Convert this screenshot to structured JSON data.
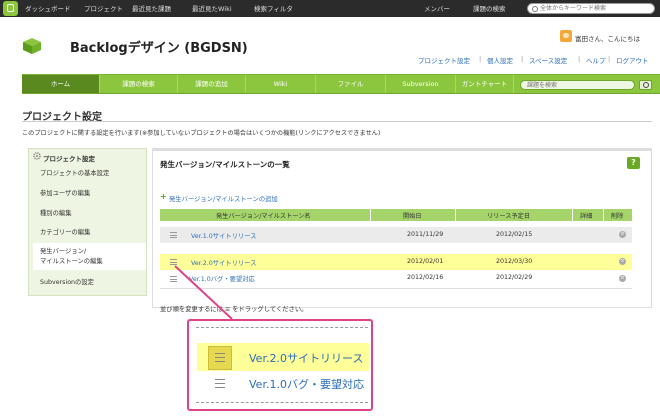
{
  "topbar": {
    "links": [
      "ダッシュボード",
      "プロジェクト",
      "最近見た課題",
      "最近見たWiki",
      "検索フィルタ"
    ],
    "right_links": [
      "メンバー",
      "課題の検索"
    ],
    "search_placeholder": "全体からキーワード検索"
  },
  "header": {
    "project_title": "Backlogデザイン (BGDSN)",
    "user_greeting": "富田さん、こんにちは",
    "links": [
      "プロジェクト設定",
      "個人設定",
      "スペース設定",
      "ヘルプ",
      "ログアウト"
    ]
  },
  "nav": {
    "tabs": [
      "ホーム",
      "課題の検索",
      "課題の追加",
      "Wiki",
      "ファイル",
      "Subversion",
      "ガントチャート"
    ],
    "search_placeholder": "課題を検索"
  },
  "page": {
    "title": "プロジェクト設定",
    "description": "このプロジェクトに関する設定を行います(※参加していないプロジェクトの場合はいくつかの機能(リンクにアクセスできません)"
  },
  "sidebar": {
    "heading": "プロジェクト設定",
    "items": [
      "プロジェクトの基本設定",
      "参加ユーザの編集",
      "種別の編集",
      "カテゴリーの編集",
      "発生バージョン/",
      "マイルストーンの編集",
      "Subversionの設定"
    ]
  },
  "main": {
    "title": "発生バージョン/マイルストーンの一覧",
    "help_label": "?",
    "add_link": "発生バージョン/マイルストーンの追加",
    "columns": [
      "発生バージョン/マイルストーン名",
      "開始日",
      "リリース予定日",
      "詳細",
      "削除"
    ],
    "rows": [
      {
        "name": "Ver.1.0サイトリリース",
        "start": "2011/11/29",
        "release": "2012/02/15"
      },
      {
        "name": "Ver.2.0サイトリリース",
        "start": "2012/02/01",
        "release": "2012/03/30"
      },
      {
        "name": "Ver.1.0バグ・要望対応",
        "start": "2012/02/16",
        "release": "2012/02/29"
      }
    ],
    "reorder_note": "並び順を変更するには ≡ をドラッグしてください。"
  },
  "callout": {
    "rows": [
      "Ver.2.0サイトリリース",
      "Ver.1.0バグ・要望対応"
    ]
  },
  "colors": {
    "accent_green": "#8cc63f",
    "highlight_yellow": "#ffff99",
    "callout_pink": "#e0438a",
    "link_blue": "#2a6ebb"
  }
}
